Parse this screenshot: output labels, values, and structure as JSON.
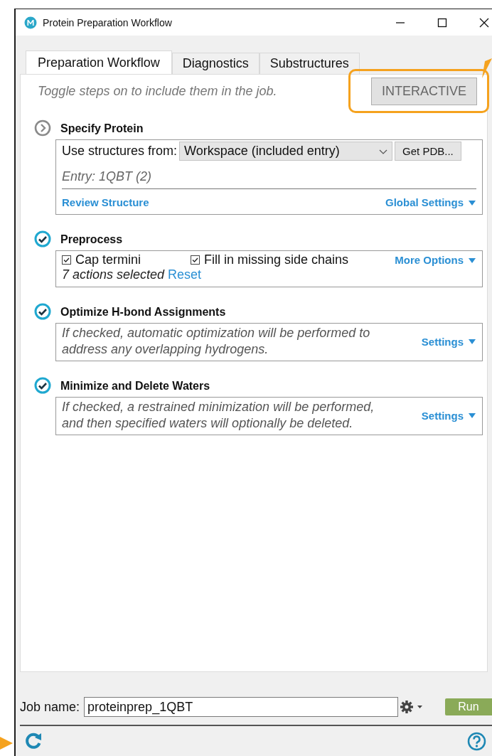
{
  "window": {
    "title": "Protein Preparation Workflow"
  },
  "tabs": [
    {
      "label": "Preparation Workflow",
      "selected": true
    },
    {
      "label": "Diagnostics",
      "selected": false
    },
    {
      "label": "Substructures",
      "selected": false
    }
  ],
  "hint": "Toggle steps on to include them in the job.",
  "interactive_button": "INTERACTIVE",
  "steps": [
    {
      "kind": "source",
      "title": "Specify Protein",
      "checked": false,
      "source_label": "Use structures from:",
      "source_value": "Workspace (included entry)",
      "fetch_button": "Get PDB...",
      "entry": "Entry: 1QBT (2)",
      "review_link": "Review Structure",
      "settings_link": "Global Settings"
    },
    {
      "kind": "options",
      "title": "Preprocess",
      "checked": true,
      "options": [
        {
          "label": "Cap termini",
          "checked": true
        },
        {
          "label": "Fill in missing side chains",
          "checked": true
        }
      ],
      "settings_link": "More Options",
      "summary": "7 actions selected",
      "reset_link": "Reset"
    },
    {
      "kind": "description",
      "title": "Optimize H-bond Assignments",
      "checked": true,
      "description": "If checked, automatic optimization will be performed to address any overlapping hydrogens.",
      "settings_link": "Settings"
    },
    {
      "kind": "description",
      "title": "Minimize and Delete Waters",
      "checked": true,
      "description": "If checked, a restrained minimization will be performed, and then specified waters will optionally be deleted.",
      "settings_link": "Settings"
    }
  ],
  "job": {
    "label": "Job name:",
    "value": "proteinprep_1QBT",
    "run_button": "Run"
  }
}
